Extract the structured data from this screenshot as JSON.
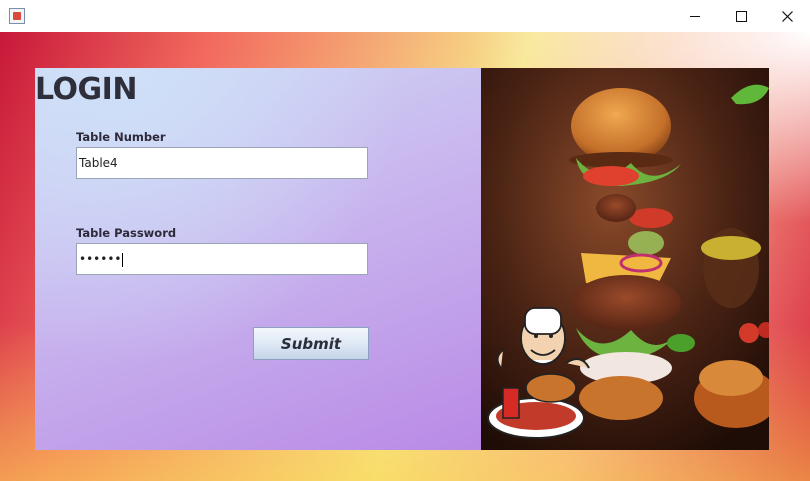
{
  "window": {
    "app_icon": "java-app-icon",
    "controls": [
      "minimize-icon",
      "maximize-icon",
      "close-icon"
    ]
  },
  "login": {
    "title": "LOGIN",
    "table_number_label": "Table Number",
    "table_number_value": "Table4",
    "table_password_label": "Table Password",
    "table_password_value": "••••••",
    "submit_label": "Submit"
  },
  "image": {
    "subject": "burger-with-chef-mascot",
    "colors": {
      "background": "#3a1a10",
      "bun": "#d08030",
      "lettuce": "#6db33f",
      "tomato": "#e0412f"
    }
  }
}
